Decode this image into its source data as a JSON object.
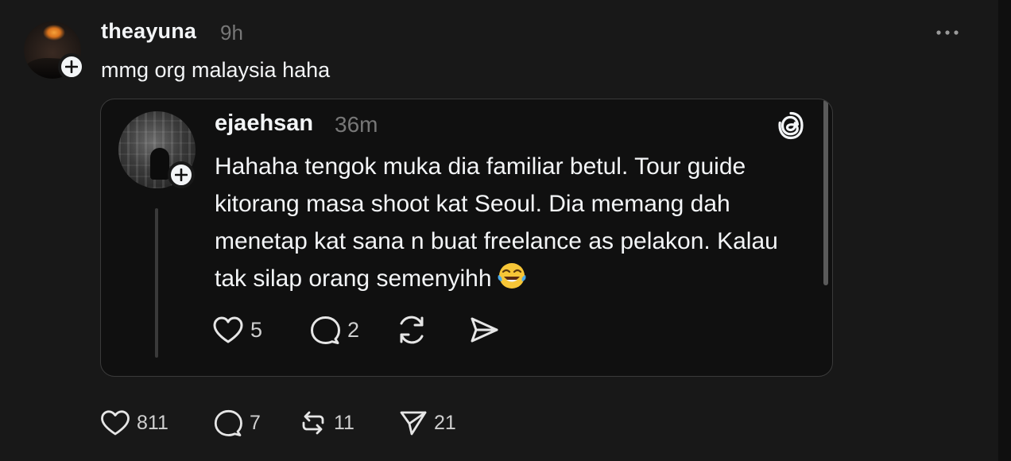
{
  "post": {
    "username": "theayuna",
    "time": "9h",
    "caption": "mmg org malaysia haha",
    "actions": {
      "likes": "811",
      "replies": "7",
      "reposts": "11",
      "shares": "21"
    }
  },
  "quoted": {
    "username": "ejaehsan",
    "time": "36m",
    "text": "Hahaha tengok muka dia familiar betul. Tour guide kitorang masa shoot kat Seoul. Dia memang dah menetap kat sana n buat freelance as pelakon. Kalau tak silap orang semenyihh",
    "emoji": "face-with-tears-of-joy",
    "actions": {
      "likes": "5",
      "replies": "2"
    }
  },
  "icons": {
    "more": "more-horizontal-icon",
    "threads": "threads-logo-icon",
    "like": "heart-icon",
    "reply": "comment-icon",
    "repost": "repost-icon",
    "share": "send-icon",
    "follow": "plus-icon"
  },
  "colors": {
    "background": "#181818",
    "card": "#101010",
    "text": "#f3f5f7",
    "muted": "#777777"
  }
}
